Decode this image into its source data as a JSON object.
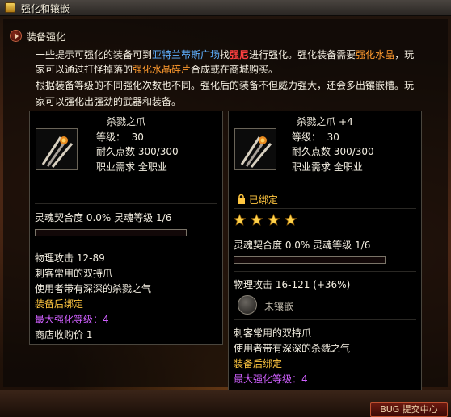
{
  "window": {
    "title": "强化和镶嵌"
  },
  "section": {
    "title": "装备强化"
  },
  "description": {
    "line1_a": "一些提示可强化的装备可到",
    "line1_place": "亚特兰蒂斯广场",
    "line1_b": "找",
    "line1_npc": "强尼",
    "line1_c": "进行强化。强化装备需要",
    "line1_item": "强化水晶",
    "line1_d": "，玩",
    "line2_a": "家可以通过打怪掉落的",
    "line2_item": "强化水晶碎片",
    "line2_b": "合成或在商城购买。",
    "line3": "根据装备等级的不同强化次数也不同。强化后的装备不但威力强大，还会多出镶嵌槽。玩",
    "line4": "家可以强化出强劲的武器和装备。"
  },
  "left_card": {
    "name": "杀戮之爪",
    "level_label": "等级：",
    "level": "30",
    "durability_label": "耐久点数",
    "durability": "300/300",
    "job_label": "职业需求",
    "job": "全职业",
    "soul_fit_label": "灵魂契合度",
    "soul_fit": "0.0%",
    "soul_level_label": "灵魂等级",
    "soul_level": "1/6",
    "soul_progress": 0.0,
    "attack_label": "物理攻击",
    "attack": "12-89",
    "desc1": "刺客常用的双持爪",
    "desc2": "使用者带有深深的杀戮之气",
    "bind": "装备后绑定",
    "max_enhance_label": "最大强化等级：",
    "max_enhance": "4",
    "sell_label": "商店收购价",
    "sell": "1"
  },
  "right_card": {
    "name": "杀戮之爪 +4",
    "level_label": "等级：",
    "level": "30",
    "durability_label": "耐久点数",
    "durability": "300/300",
    "job_label": "职业需求",
    "job": "全职业",
    "bound": "已绑定",
    "stars": 4,
    "soul_fit_label": "灵魂契合度",
    "soul_fit": "0.0%",
    "soul_level_label": "灵魂等级",
    "soul_level": "1/6",
    "soul_progress": 0.0,
    "attack_label": "物理攻击",
    "attack": "16-121",
    "attack_bonus": "(+36%)",
    "socket": "未镶嵌",
    "desc1": "刺客常用的双持爪",
    "desc2": "使用者带有深深的杀戮之气",
    "bind": "装备后绑定",
    "max_enhance_label": "最大强化等级：",
    "max_enhance": "4"
  },
  "bug_button": "BUG 提交中心",
  "colors": {
    "gold": "#ffc640",
    "magenta": "#d060ff",
    "blue": "#5fb0ff",
    "red": "#ff4040",
    "orange": "#ff9a2e"
  }
}
